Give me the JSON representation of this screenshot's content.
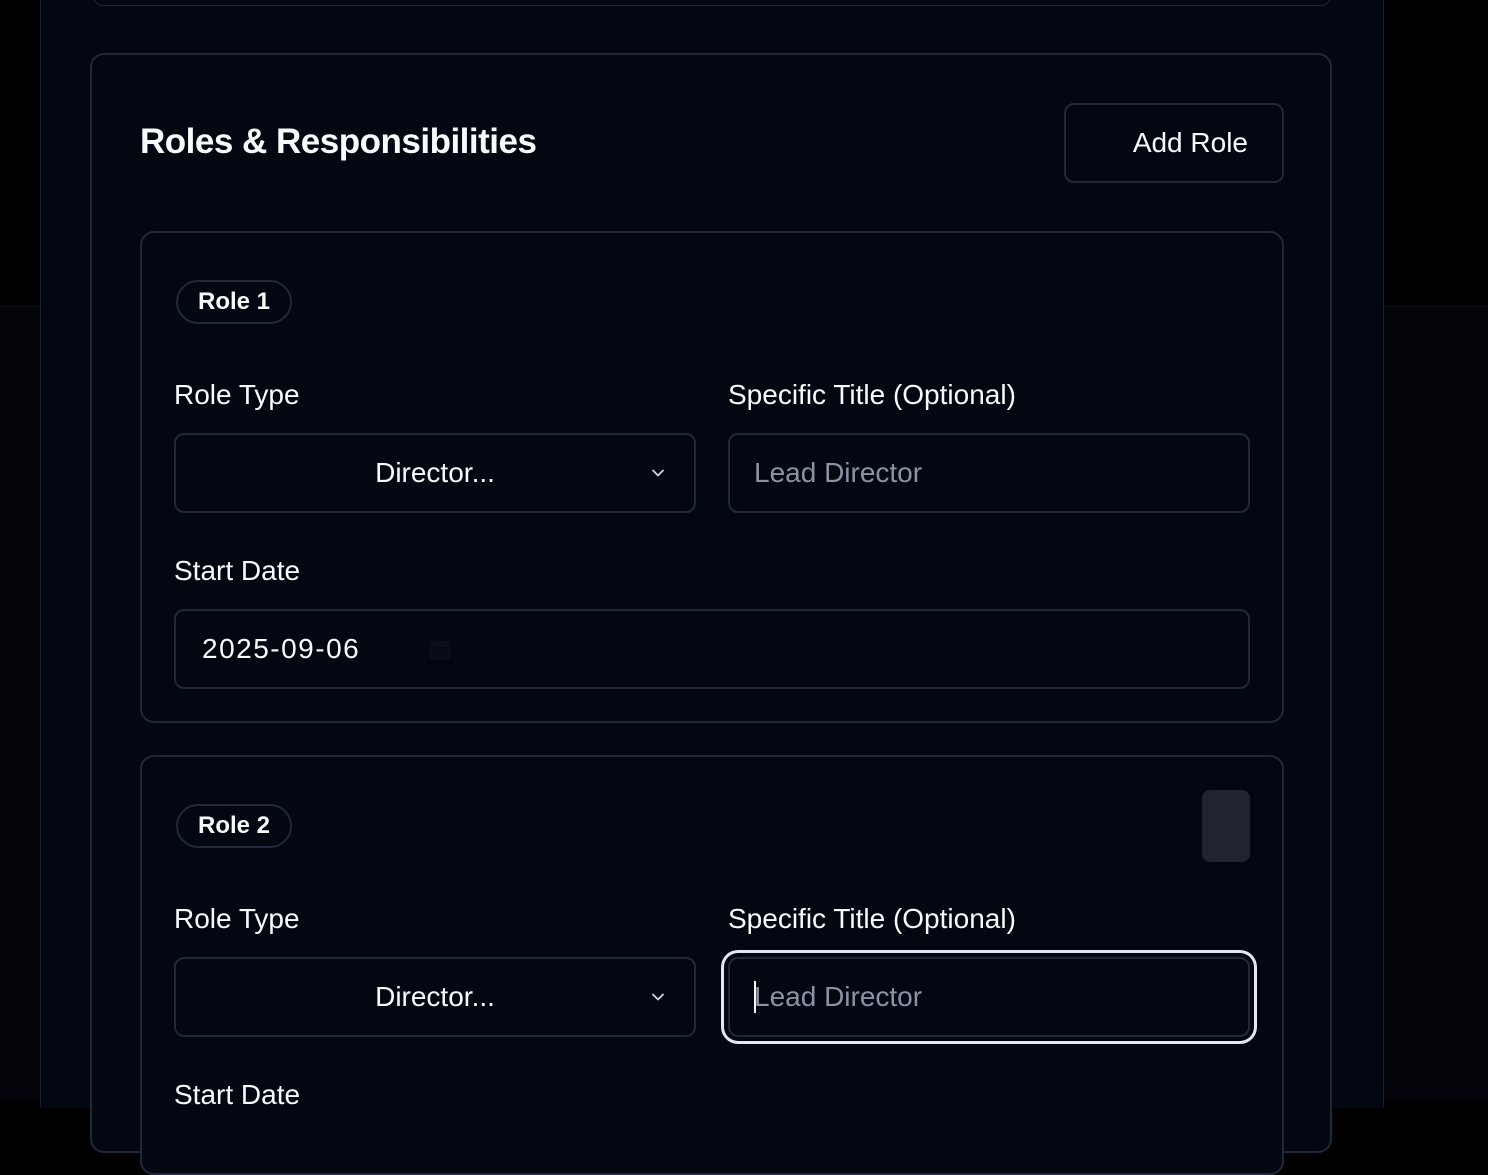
{
  "section": {
    "title": "Roles & Responsibilities",
    "add_role_label": "Add Role"
  },
  "roles": [
    {
      "badge": "Role 1",
      "role_type_label": "Role Type",
      "role_type_value": "Director...",
      "title_label": "Specific Title (Optional)",
      "title_placeholder": "Lead Director",
      "title_value": "",
      "start_date_label": "Start Date",
      "start_date_value": "2025-09-06"
    },
    {
      "badge": "Role 2",
      "role_type_label": "Role Type",
      "role_type_value": "Director...",
      "title_label": "Specific Title (Optional)",
      "title_placeholder": "Lead Director",
      "title_value": "",
      "start_date_label": "Start Date"
    }
  ],
  "icons": {
    "select_chevron": "chevron-down-icon",
    "date_picker": "calendar-icon"
  },
  "colors": {
    "background": "#030712",
    "border": "#1f2937",
    "text": "#f8fafc",
    "placeholder": "#8b93a3",
    "focus_ring": "#e5e7f0",
    "remove_button": "#1f2430"
  }
}
